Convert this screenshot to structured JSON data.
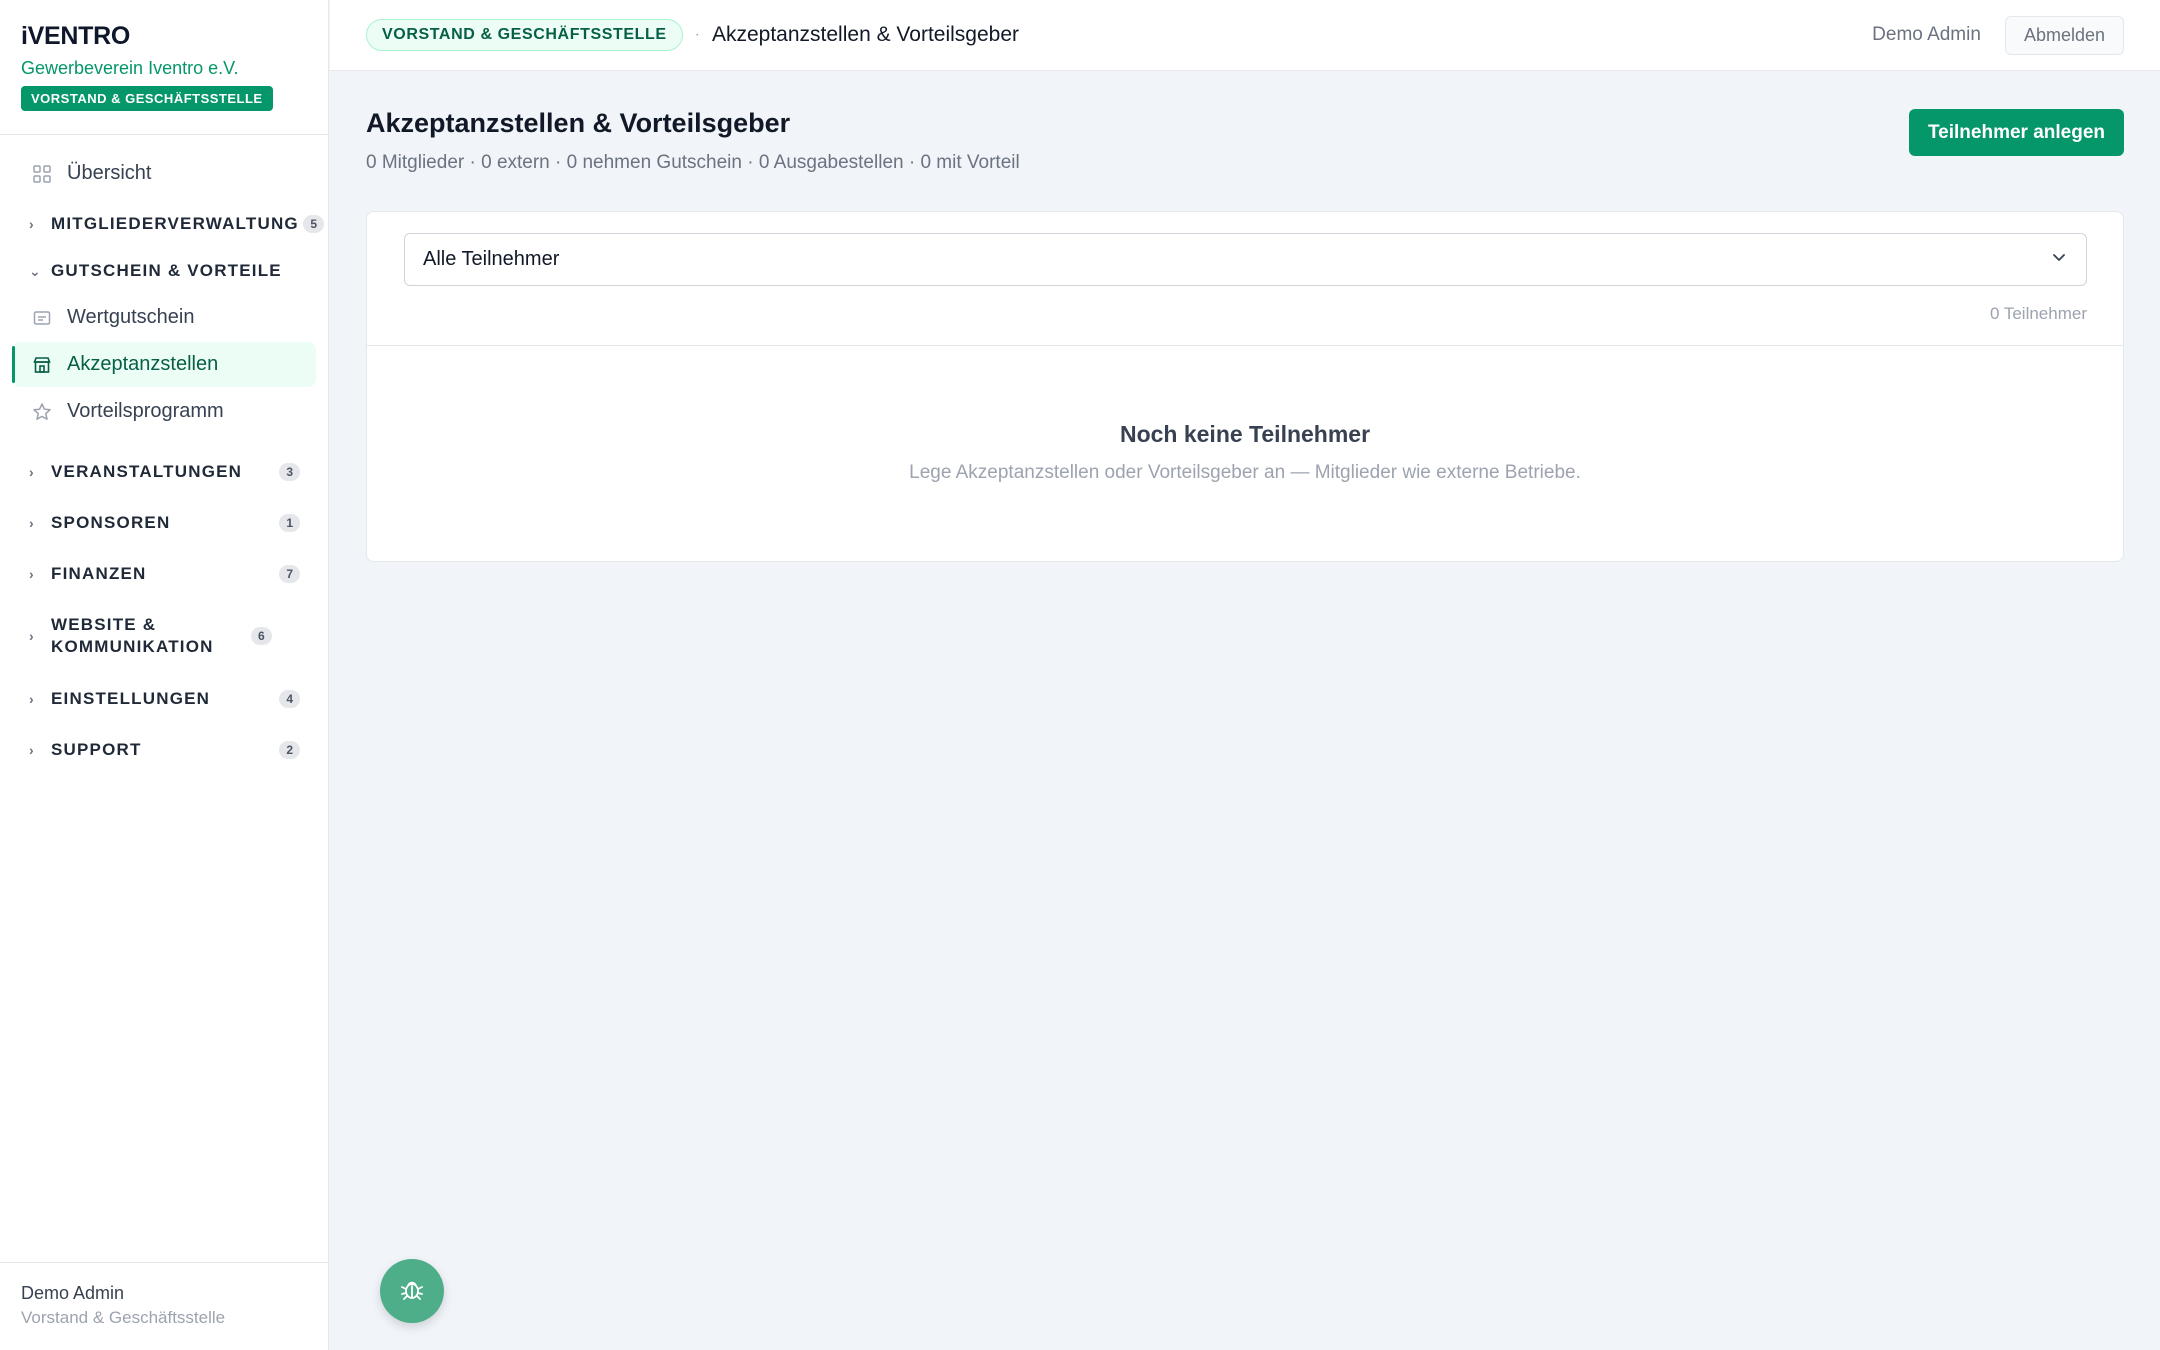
{
  "brand": {
    "logo": "iVENTRO",
    "org": "Gewerbeverein Iventro e.V.",
    "role": "VORSTAND & GESCHÄFTSSTELLE"
  },
  "nav": {
    "overview": "Übersicht",
    "groups": {
      "mitglieder": {
        "label": "MITGLIEDERVERWALTUNG",
        "count": "5"
      },
      "gutschein": {
        "label": "GUTSCHEIN & VORTEILE"
      },
      "veranstaltungen": {
        "label": "VERANSTALTUNGEN",
        "count": "3"
      },
      "sponsoren": {
        "label": "SPONSOREN",
        "count": "1"
      },
      "finanzen": {
        "label": "FINANZEN",
        "count": "7"
      },
      "website": {
        "label": "WEBSITE & KOMMUNIKATION",
        "count": "6"
      },
      "einstellungen": {
        "label": "EINSTELLUNGEN",
        "count": "4"
      },
      "support": {
        "label": "SUPPORT",
        "count": "2"
      }
    },
    "gutschein_items": {
      "wertgutschein": "Wertgutschein",
      "akzeptanzstellen": "Akzeptanzstellen",
      "vorteilsprogramm": "Vorteilsprogramm"
    }
  },
  "sidebar_footer": {
    "name": "Demo Admin",
    "role": "Vorstand & Geschäftsstelle"
  },
  "topbar": {
    "role_pill": "VORSTAND & GESCHÄFTSSTELLE",
    "separator": "·",
    "title": "Akzeptanzstellen & Vorteilsgeber",
    "user": "Demo Admin",
    "logout": "Abmelden"
  },
  "page": {
    "title": "Akzeptanzstellen & Vorteilsgeber",
    "subtitle": "0 Mitglieder · 0 extern · 0 nehmen Gutschein · 0 Ausgabestellen · 0 mit Vorteil",
    "primary_button": "Teilnehmer anlegen"
  },
  "filter": {
    "selected": "Alle Teilnehmer",
    "count": "0 Teilnehmer"
  },
  "empty": {
    "title": "Noch keine Teilnehmer",
    "subtitle": "Lege Akzeptanzstellen oder Vorteilsgeber an — Mitglieder wie externe Betriebe."
  },
  "colors": {
    "accent": "#059669",
    "accent_light": "#ecfdf5",
    "fab": "#4fae8a"
  }
}
